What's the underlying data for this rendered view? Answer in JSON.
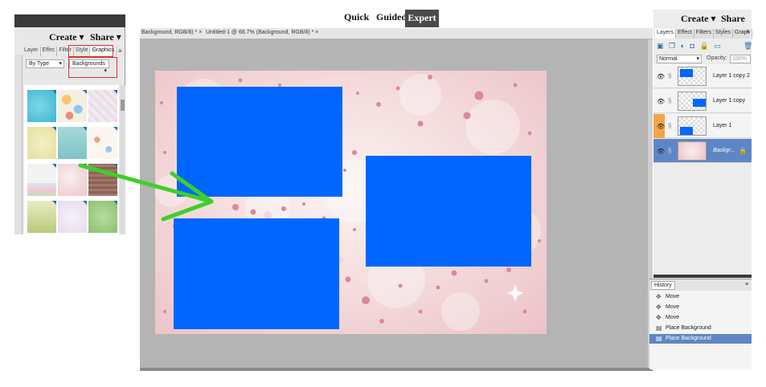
{
  "modes": {
    "quick": "Quick",
    "guided": "Guided",
    "expert": "Expert"
  },
  "left_panel": {
    "create": "Create",
    "share": "Share",
    "tabs": [
      "Layer",
      "Effec",
      "Filter",
      "Style",
      "Graphics"
    ],
    "menu": "≡",
    "by_type": "By Type",
    "category": "Backgrounds",
    "chevron": "▾"
  },
  "doc_tabs": {
    "first": "Background, RGB/8) * ×",
    "second": "Untitled-1 @ 66.7% (Background, RGB/8) * ×"
  },
  "right_panel": {
    "create": "Create",
    "share": "Share",
    "tabs": [
      "Layers",
      "Effect",
      "Filters",
      "Styles",
      "Graph"
    ],
    "menu": "≡",
    "tool_icons": "▣ ❐ ◐ ◘ 🔒 ▭",
    "trash_icon": "🗑",
    "blend_mode": "Normal",
    "opacity_label": "Opacity:",
    "opacity_value": "100%",
    "layers": [
      {
        "name": "Layer 1 copy 2"
      },
      {
        "name": "Layer 1 copy"
      },
      {
        "name": "Layer 1"
      },
      {
        "name": "Backgr..."
      }
    ]
  },
  "history": {
    "title": "History",
    "menu": "≡",
    "items": [
      {
        "label": "Move"
      },
      {
        "label": "Move"
      },
      {
        "label": "Move"
      },
      {
        "label": "Place Background"
      },
      {
        "label": "Place Background"
      }
    ]
  },
  "colors": {
    "accent_blue": "#0066ff",
    "arrow_green": "#3ecf2a",
    "highlight_red": "#e0302a",
    "selected_row": "#5f86c4"
  }
}
